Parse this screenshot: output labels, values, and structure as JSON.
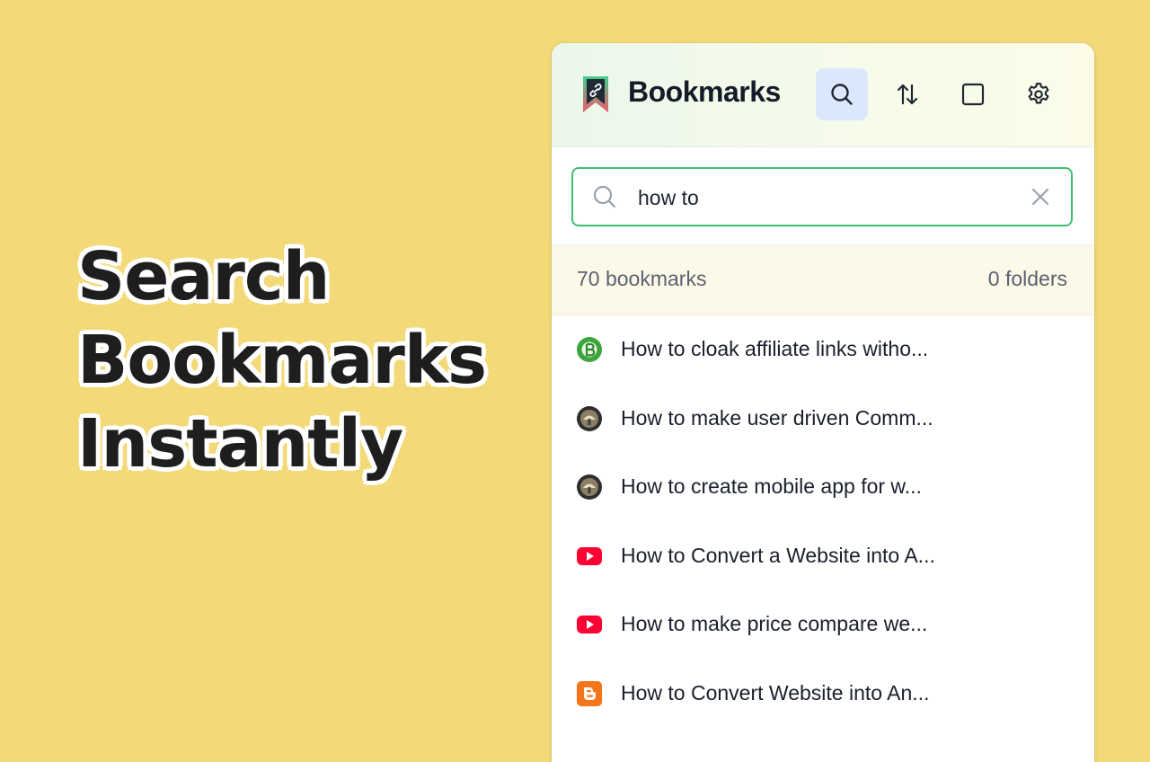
{
  "headline": [
    "Search",
    "Bookmarks",
    "Instantly"
  ],
  "header": {
    "title": "Bookmarks",
    "tools": [
      "search-icon",
      "sort-icon",
      "square-icon",
      "gear-icon"
    ]
  },
  "search": {
    "value": "how to",
    "placeholder": ""
  },
  "stats": {
    "bookmarks": "70 bookmarks",
    "folders": "0 folders"
  },
  "bookmarks": [
    {
      "title": "How to cloak affiliate links witho...",
      "favicon": "green-b-favicon"
    },
    {
      "title": "How to make user driven Comm...",
      "favicon": "dark-round-favicon"
    },
    {
      "title": "How to create mobile app for w...",
      "favicon": "dark-round-favicon"
    },
    {
      "title": "How to Convert a Website into A...",
      "favicon": "youtube-favicon"
    },
    {
      "title": "How to make price compare we...",
      "favicon": "youtube-favicon"
    },
    {
      "title": "How to Convert Website into An...",
      "favicon": "blogger-favicon"
    }
  ],
  "colors": {
    "background": "#f3d977",
    "accent_green": "#3fbf72",
    "active_tool": "#dbe7fb",
    "youtube": "#ff0033",
    "blogger": "#f5761a"
  }
}
